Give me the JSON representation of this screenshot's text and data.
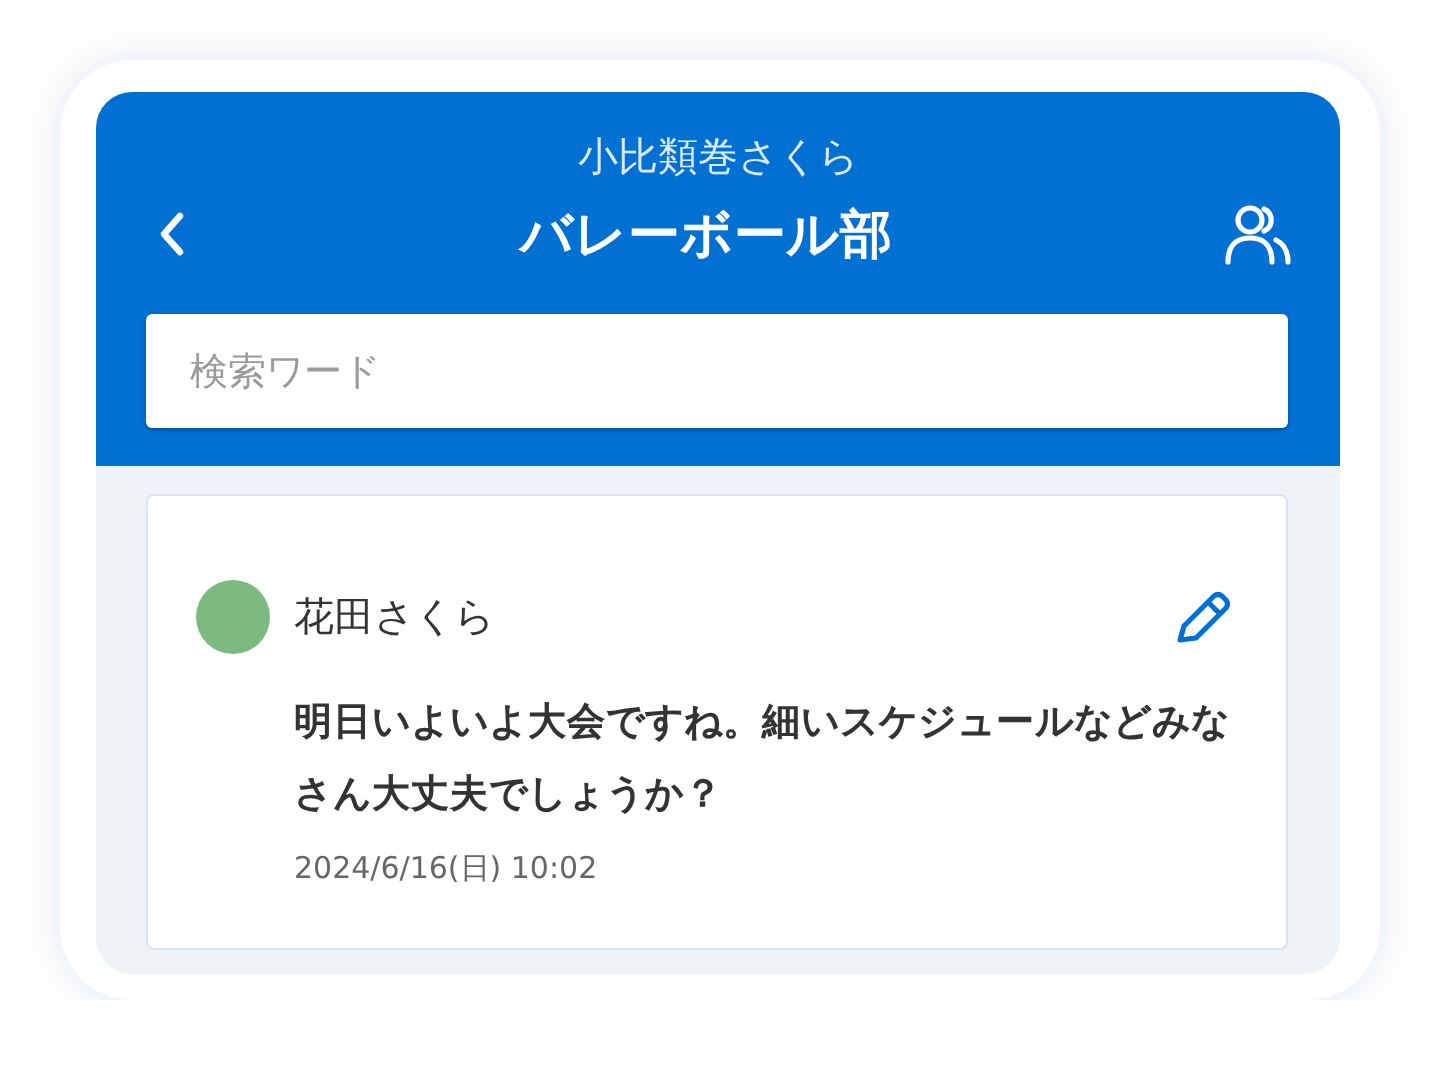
{
  "header": {
    "subtitle": "小比類巻さくら",
    "title": "バレーボール部"
  },
  "search": {
    "placeholder": "検索ワード"
  },
  "posts": [
    {
      "author": "花田さくら",
      "color": "#7dba7f",
      "message": "明日いよいよ大会ですね。細いスケジュールなどみなさん大丈夫でしょうか？",
      "time": "2024/6/16(日) 10:02"
    }
  ]
}
